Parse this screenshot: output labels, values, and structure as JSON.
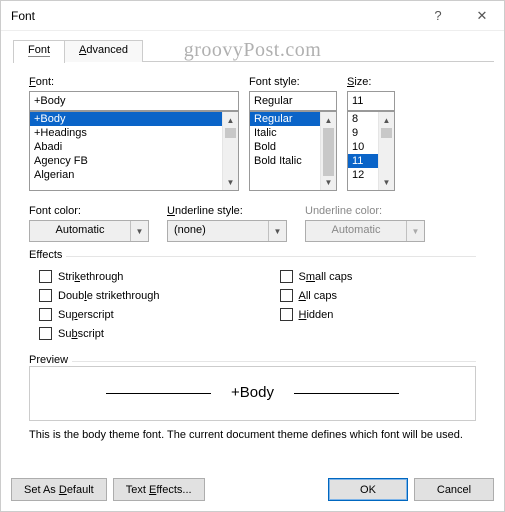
{
  "window": {
    "title": "Font"
  },
  "watermark": "groovyPost.com",
  "tabs": {
    "font": "Font",
    "advanced": "Advanced"
  },
  "fields": {
    "font_label": "Font:",
    "font_value": "+Body",
    "font_items": [
      "+Body",
      "+Headings",
      "Abadi",
      "Agency FB",
      "Algerian"
    ],
    "style_label": "Font style:",
    "style_value": "Regular",
    "style_items": [
      "Regular",
      "Italic",
      "Bold",
      "Bold Italic"
    ],
    "size_label": "Size:",
    "size_value": "11",
    "size_items": [
      "8",
      "9",
      "10",
      "11",
      "12"
    ]
  },
  "mid": {
    "color_label": "Font color:",
    "color_value": "Automatic",
    "uline_label": "Underline style:",
    "uline_value": "(none)",
    "ucolor_label": "Underline color:",
    "ucolor_value": "Automatic"
  },
  "effects": {
    "title": "Effects",
    "strike": "Strikethrough",
    "double": "Double strikethrough",
    "super": "Superscript",
    "sub": "Subscript",
    "smallcaps": "Small caps",
    "allcaps": "All caps",
    "hidden": "Hidden"
  },
  "preview": {
    "title": "Preview",
    "text": "+Body",
    "desc": "This is the body theme font. The current document theme defines which font will be used."
  },
  "buttons": {
    "default": "Set As Default",
    "effects": "Text Effects...",
    "ok": "OK",
    "cancel": "Cancel"
  }
}
